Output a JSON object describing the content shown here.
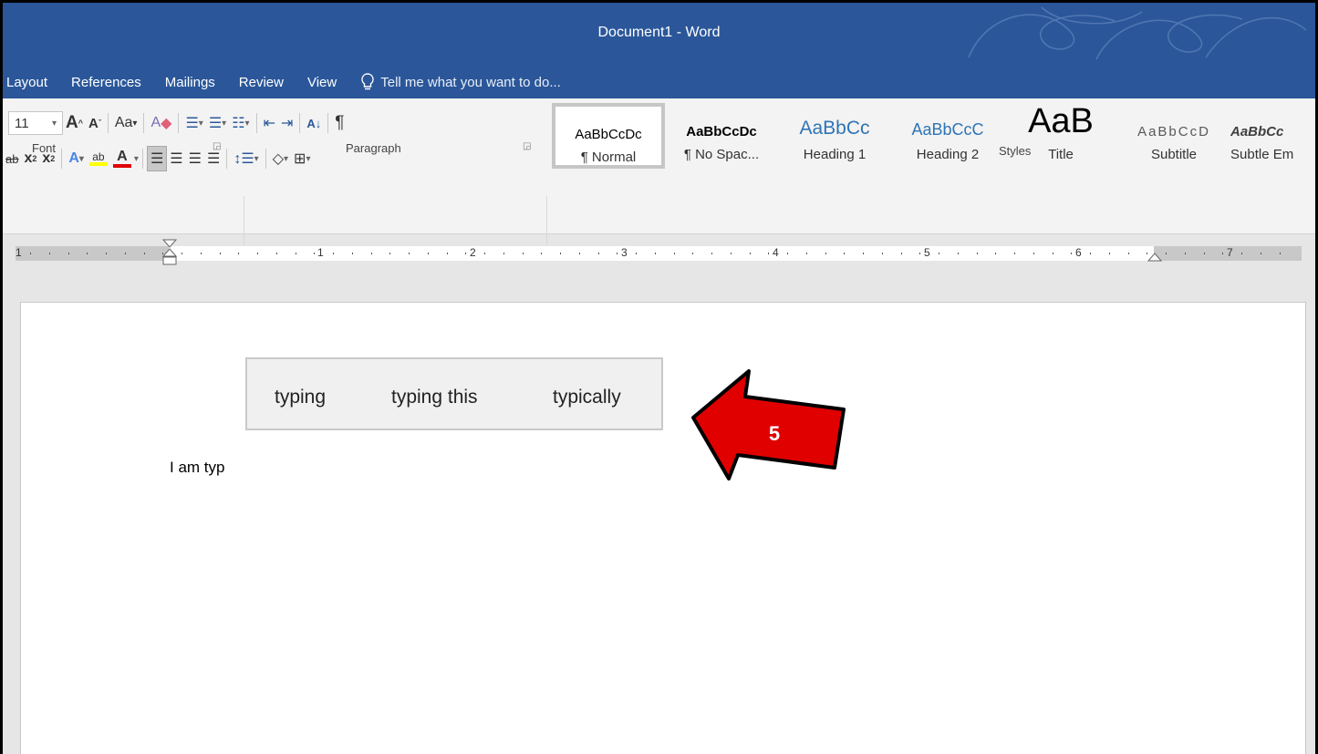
{
  "window": {
    "title": "Document1 - Word"
  },
  "tabs": [
    "Layout",
    "References",
    "Mailings",
    "Review",
    "View"
  ],
  "tell_me": {
    "text": "Tell me what you want to do..."
  },
  "font_group": {
    "size": "11",
    "label": "Font"
  },
  "paragraph_group": {
    "label": "Paragraph"
  },
  "styles_group": {
    "label": "Styles",
    "items": [
      {
        "sample": "AaBbCcDc",
        "name": "¶ Normal"
      },
      {
        "sample": "AaBbCcDc",
        "name": "¶ No Spac..."
      },
      {
        "sample": "AaBbCc",
        "name": "Heading 1"
      },
      {
        "sample": "AaBbCcC",
        "name": "Heading 2"
      },
      {
        "sample": "AaB",
        "name": "Title"
      },
      {
        "sample": "AaBbCcD",
        "name": "Subtitle"
      },
      {
        "sample": "AaBbCc",
        "name": "Subtle Em"
      }
    ]
  },
  "ruler": {
    "numbers": [
      "1",
      "1",
      "2",
      "3",
      "4",
      "5",
      "6",
      "7"
    ]
  },
  "document": {
    "text": "I am typ"
  },
  "suggestions": [
    "typing",
    "typing this",
    "typically"
  ],
  "callout": {
    "number": "5",
    "color": "#e00000"
  },
  "colors": {
    "accent": "#2b579a",
    "highlight": "#ffff00",
    "font_color": "#e00000"
  }
}
